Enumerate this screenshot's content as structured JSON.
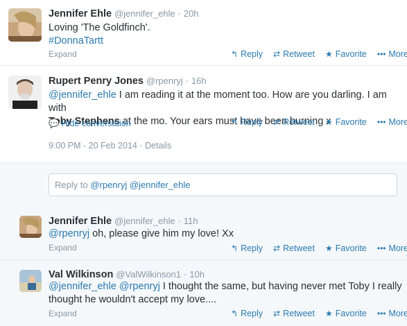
{
  "tweets": [
    {
      "name": "Jennifer Ehle",
      "handle": "@jennifer_ehle",
      "time": "20h",
      "text_plain": "Loving 'The Goldfinch'.",
      "hashtag": "#DonnaTartt",
      "expand": "Expand"
    },
    {
      "name": "Rupert Penry Jones",
      "handle": "@rpenryj",
      "time": "16h",
      "mention": "@jennifer_ehle",
      "text_line1": " I am reading it at the moment too. How are you darling. I am with",
      "text_bold": "Toby Stephens",
      "text_line2": " at the mo. Your ears must have been burning x",
      "hide_conversation": "Hide conversation",
      "timestamp": "9:00 PM - 20 Feb 2014",
      "details": "Details"
    },
    {
      "name": "Jennifer Ehle",
      "handle": "@jennifer_ehle",
      "time": "11h",
      "mention": "@rpenryj",
      "text": " oh, please give him my love! Xx",
      "expand": "Expand"
    },
    {
      "name": "Val Wilkinson",
      "handle": "@ValWilkinson1",
      "time": "10h",
      "mention1": "@jennifer_ehle",
      "mention2": "@rpenryj",
      "text_line1": " I thought the same, but having never met Toby I really",
      "text_line2": "thought he wouldn't accept my love....",
      "expand": "Expand"
    }
  ],
  "reply_box": {
    "prefix": "Reply to ",
    "mentions": "@rpenryj @jennifer_ehle"
  },
  "actions": {
    "reply": "Reply",
    "retweet": "Retweet",
    "favorite": "Favorite",
    "more": "More"
  },
  "separator": "·",
  "icons": {
    "reply": "reply-arrow-icon",
    "retweet": "retweet-icon",
    "favorite": "star-icon",
    "more": "ellipsis-icon",
    "hide": "chat-bubble-icon"
  },
  "colors": {
    "link": "#2a7ab0",
    "muted": "#8899a6",
    "text": "#292f33"
  }
}
